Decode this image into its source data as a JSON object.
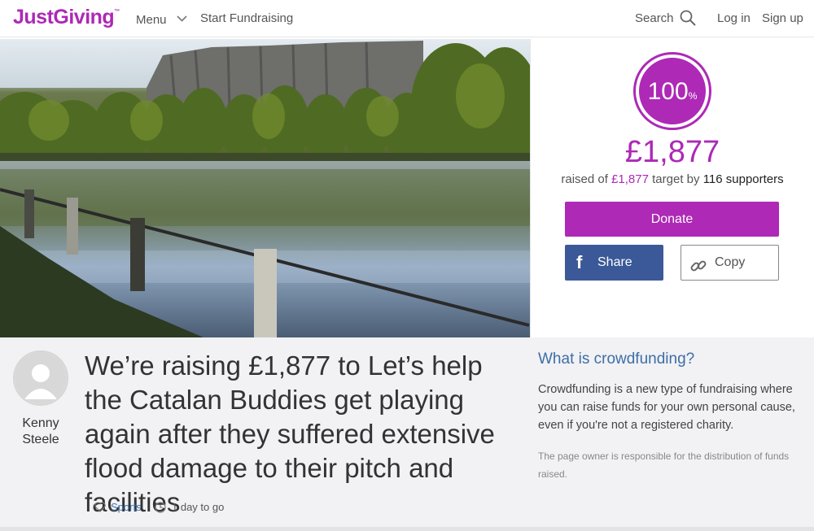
{
  "header": {
    "logo": "JustGiving",
    "logo_tm": "™",
    "menu_label": "Menu",
    "start_label": "Start Fundraising",
    "search_label": "Search",
    "login_label": "Log in",
    "signup_label": "Sign up"
  },
  "progress": {
    "percent": "100",
    "percent_sign": "%",
    "raised": "£1,877",
    "raised_prefix": "raised of",
    "target": "£1,877",
    "target_mid": "target by",
    "supporters": "116 supporters"
  },
  "actions": {
    "donate": "Donate",
    "share": "Share",
    "copy": "Copy"
  },
  "owner": {
    "first_name": "Kenny",
    "last_name": "Steele"
  },
  "page": {
    "title": "We’re raising £1,877 to Let’s help the Catalan Buddies get playing again after they suffered extensive flood damage to their pitch and facilities",
    "category": "Sports",
    "time_left": "1 day to go"
  },
  "info": {
    "heading": "What is crowdfunding?",
    "description": "Crowdfunding is a new type of fundraising where you can raise funds for your own personal cause, even if you're not a registered charity.",
    "disclaimer": "The page owner is responsible for the distribution of funds raised."
  },
  "colors": {
    "brand": "#ad29b6",
    "facebook": "#3b5998",
    "link": "#3c6fa6"
  },
  "icons": [
    "chevron-down-icon",
    "search-icon",
    "facebook-icon",
    "link-icon",
    "heart-icon",
    "clock-icon",
    "avatar-icon"
  ]
}
